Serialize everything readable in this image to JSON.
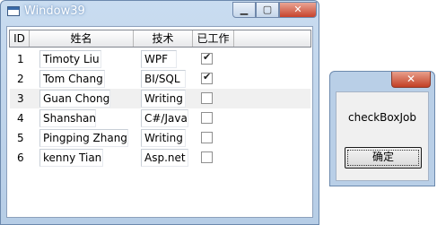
{
  "main_window": {
    "title": "Window39",
    "controls": {
      "minimize": "▁",
      "maximize": "▢",
      "close": "✕"
    }
  },
  "grid": {
    "columns": [
      "ID",
      "姓名",
      "技术",
      "已工作"
    ],
    "rows": [
      {
        "id": "1",
        "name": "Timoty Liu",
        "tech": "WPF",
        "worked": true
      },
      {
        "id": "2",
        "name": "Tom Chang",
        "tech": "BI/SQL",
        "worked": true
      },
      {
        "id": "3",
        "name": "Guan Chong",
        "tech": "Writing",
        "worked": false
      },
      {
        "id": "4",
        "name": "Shanshan",
        "tech": "C#/Java",
        "worked": false
      },
      {
        "id": "5",
        "name": "Pingping Zhang",
        "tech": "Writing",
        "worked": false
      },
      {
        "id": "6",
        "name": "kenny Tian",
        "tech": "Asp.net",
        "worked": false
      }
    ]
  },
  "message_box": {
    "close": "✕",
    "message": "checkBoxJob",
    "ok_label": "确定"
  }
}
